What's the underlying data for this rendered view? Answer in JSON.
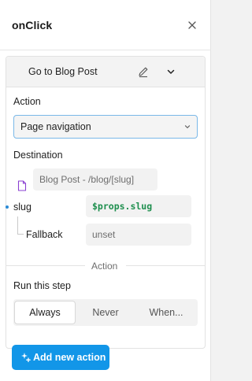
{
  "panel": {
    "title": "onClick",
    "close_icon": "close-icon"
  },
  "action_card": {
    "title": "Go to Blog Post",
    "edit_icon": "pencil-icon",
    "collapse_icon": "chevron-down-icon",
    "action_label": "Action",
    "action_value": "Page navigation",
    "destination_label": "Destination",
    "destination_icon": "document-icon",
    "destination_value": "Blog Post - /blog/[slug]",
    "params": {
      "slug_label": "slug",
      "slug_value": "$props.slug",
      "fallback_label": "Fallback",
      "fallback_placeholder": "unset"
    },
    "divider_label": "Action",
    "run_label": "Run this step",
    "run_options": [
      "Always",
      "Never",
      "When..."
    ],
    "run_selected": "Always"
  },
  "add_action_button": {
    "label": "Add new action",
    "icon": "sparkle-plus-icon"
  },
  "colors": {
    "accent": "#1296e8",
    "select_border": "#7ab8e8",
    "code_green": "#1e8f4e"
  }
}
